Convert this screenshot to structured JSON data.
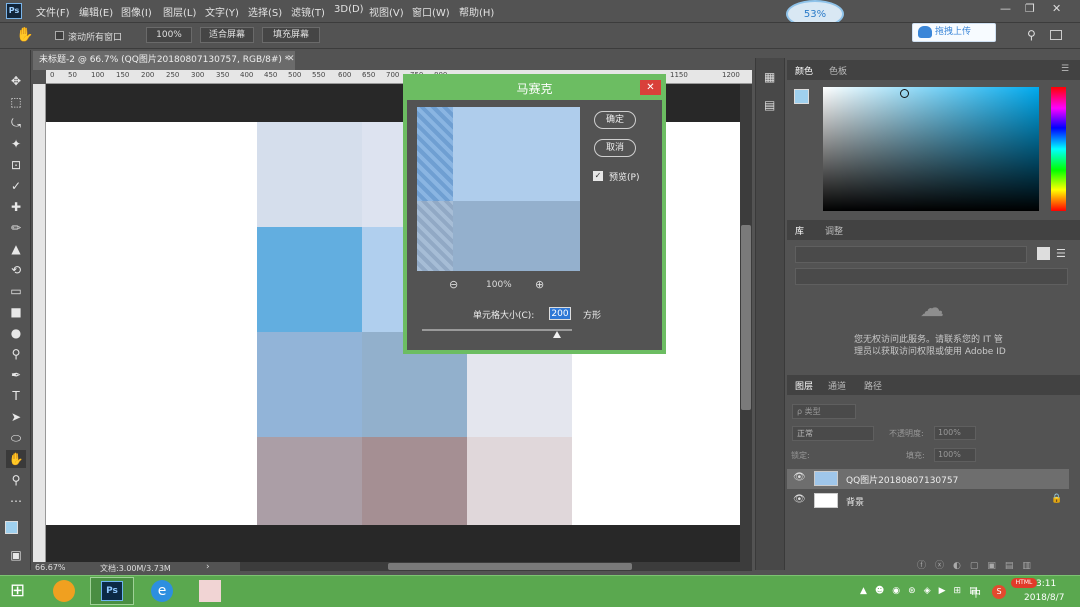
{
  "app": {
    "logo": "Ps",
    "zoom_indicator": "53%"
  },
  "menu": [
    "文件(F)",
    "编辑(E)",
    "图像(I)",
    "图层(L)",
    "文字(Y)",
    "选择(S)",
    "滤镜(T)",
    "3D(D)",
    "视图(V)",
    "窗口(W)",
    "帮助(H)"
  ],
  "options_bar": {
    "scroll_all_label": "滚动所有窗口",
    "zoom_value": "100%",
    "fit_screen": "适合屏幕",
    "fill_screen": "填充屏幕",
    "upload": "拖拽上传"
  },
  "document": {
    "tab_title": "未标题-2 @ 66.7% (QQ图片20180807130757, RGB/8#) *",
    "ruler_labels": [
      "0",
      "50",
      "100",
      "150",
      "200",
      "250",
      "300",
      "350",
      "400",
      "450",
      "500",
      "550",
      "600",
      "650",
      "700",
      "750",
      "800",
      "1150",
      "1200"
    ],
    "zoom": "66.67%",
    "doc_info": "文档:3.00M/3.73M"
  },
  "mosaic_tiles": [
    "#d5deec",
    "#dde3f0",
    "#62aee0",
    "#b0cfee",
    "#92b4d8",
    "#92b0cc",
    "#e4e6ee",
    "#ab9ea6",
    "#a58f93",
    "#e0d7da"
  ],
  "dialog": {
    "title": "马赛克",
    "ok": "确定",
    "cancel": "取消",
    "preview_label": "预览(P)",
    "preview_checked": true,
    "zoom": "100%",
    "cell_size_label": "单元格大小(C):",
    "cell_size_value": "200",
    "cell_unit": "方形",
    "cell_size_slider": 0.9
  },
  "panels": {
    "color_tabs": [
      "颜色",
      "色板"
    ],
    "library_tabs": [
      "库",
      "调整"
    ],
    "library_message_1": "您无权访问此服务。请联系您的 IT 管",
    "library_message_2": "理员以获取访问权限或使用 Adobe ID",
    "layers_tabs": [
      "图层",
      "通道",
      "路径"
    ],
    "layer_filter": "ρ 类型",
    "blend_mode": "正常",
    "opacity_label": "不透明度:",
    "opacity_value": "100%",
    "lock_label": "锁定:",
    "fill_label": "填充:",
    "fill_value": "100%",
    "layers": [
      {
        "name": "QQ图片20180807130757"
      },
      {
        "name": "背景"
      }
    ]
  },
  "taskbar": {
    "time": "3:11",
    "date": "2018/8/7",
    "tray_badge": "HTML",
    "ime": "中"
  }
}
